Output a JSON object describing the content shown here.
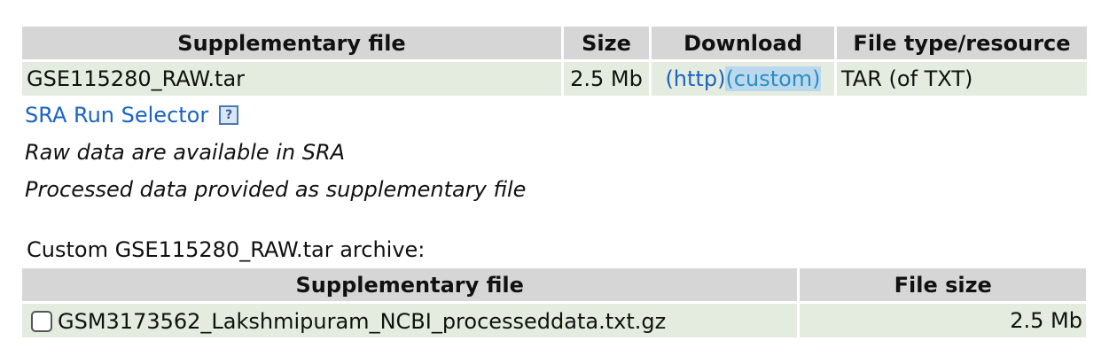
{
  "supp_table": {
    "headers": [
      "Supplementary file",
      "Size",
      "Download",
      "File type/resource"
    ],
    "row": {
      "file": "GSE115280_RAW.tar",
      "size": "2.5 Mb",
      "download_http": "(http)",
      "download_custom": "(custom)",
      "file_type": "TAR (of TXT)"
    }
  },
  "sra_link": "SRA Run Selector",
  "help_icon_glyph": "?",
  "raw_note": "Raw data are available in SRA",
  "processed_note": "Processed data provided as supplementary file",
  "custom_archive_label": "Custom GSE115280_RAW.tar archive:",
  "custom_table": {
    "headers": [
      "Supplementary file",
      "File size"
    ],
    "rows": [
      {
        "file": "GSM3173562_Lakshmipuram_NCBI_processeddata.txt.gz",
        "size": "2.5 Mb",
        "checked": false
      }
    ]
  },
  "colors": {
    "header_bg": "#d6d6d6",
    "row_bg": "#e3ecdf",
    "link": "#1a63c4",
    "custom_highlight_bg": "#bcd8ee"
  }
}
